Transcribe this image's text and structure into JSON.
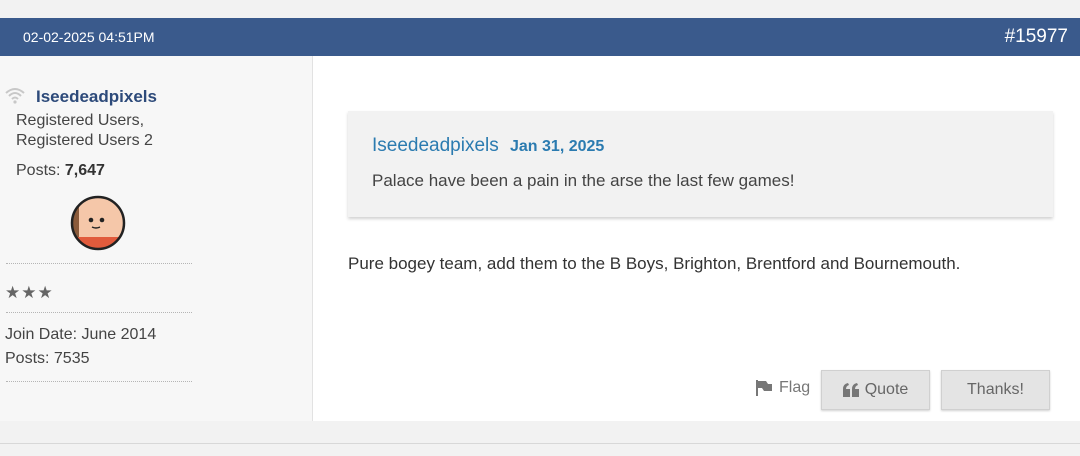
{
  "post": {
    "date": "02-02-2025 04:51PM",
    "number": "#15977"
  },
  "user": {
    "username": "Iseedeadpixels",
    "groups_line1": "Registered Users,",
    "groups_line2": "Registered Users 2",
    "posts_label": "Posts: ",
    "posts_count": "7,647",
    "stars": "★★★",
    "join_date": "Join Date: June 2014",
    "posts_plain": "Posts: 7535",
    "online_icon": "wifi-signal-icon",
    "avatar_icon": "smiley-face-avatar"
  },
  "quote": {
    "author": "Iseedeadpixels",
    "date": "Jan 31, 2025",
    "text": "Palace have been a pain in the arse the last few games!"
  },
  "message": "Pure bogey team, add them to the B Boys, Brighton, Brentford and Bournemouth.",
  "actions": {
    "flag": "Flag",
    "quote": "Quote",
    "thanks": "Thanks!"
  },
  "colors": {
    "header_bg": "#3a5a8c",
    "username": "#2d4a7a",
    "quote_link": "#2b7bb0"
  }
}
